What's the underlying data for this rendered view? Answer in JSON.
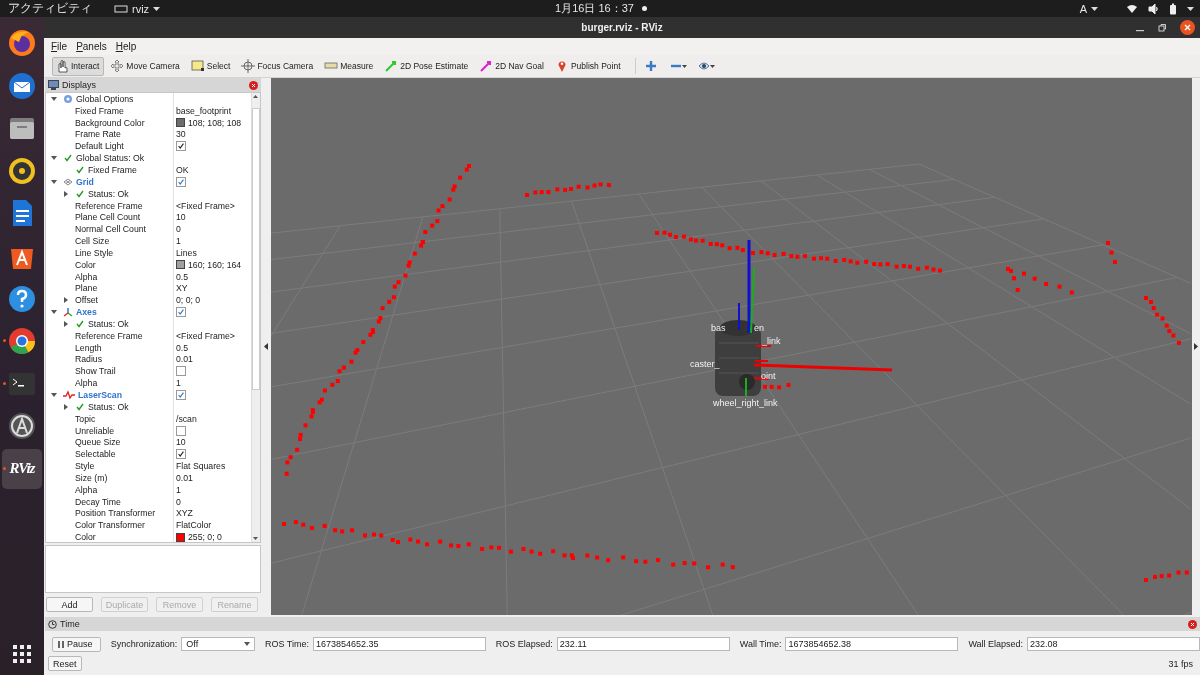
{
  "top_bar": {
    "activities": "アクティビティ",
    "app_menu": "rviz",
    "clock": "1月16日 16：37",
    "input_method": "A"
  },
  "dock": {
    "items": [
      {
        "kind": "firefox",
        "running": false,
        "selected": false
      },
      {
        "kind": "thunderbird",
        "running": false,
        "selected": false
      },
      {
        "kind": "files",
        "running": false,
        "selected": false
      },
      {
        "kind": "rhythmbox",
        "running": false,
        "selected": false
      },
      {
        "kind": "writer",
        "running": false,
        "selected": false
      },
      {
        "kind": "software",
        "running": false,
        "selected": false
      },
      {
        "kind": "help",
        "running": false,
        "selected": false
      },
      {
        "kind": "chrome",
        "running": true,
        "selected": false
      },
      {
        "kind": "terminal",
        "running": true,
        "selected": false
      },
      {
        "kind": "updater",
        "running": false,
        "selected": false
      },
      {
        "kind": "rviz",
        "label": "RViz",
        "running": true,
        "selected": true
      }
    ]
  },
  "window": {
    "title": "burger.rviz - RViz"
  },
  "menu": [
    "File",
    "Panels",
    "Help"
  ],
  "toolbar": [
    {
      "kind": "interact",
      "label": "Interact",
      "selected": true
    },
    {
      "kind": "move_camera",
      "label": "Move Camera",
      "selected": false
    },
    {
      "kind": "select",
      "label": "Select",
      "selected": false
    },
    {
      "kind": "focus_camera",
      "label": "Focus Camera",
      "selected": false
    },
    {
      "kind": "measure",
      "label": "Measure",
      "selected": false
    },
    {
      "kind": "pose_estimate",
      "label": "2D Pose Estimate",
      "selected": false
    },
    {
      "kind": "nav_goal",
      "label": "2D Nav Goal",
      "selected": false
    },
    {
      "kind": "publish_point",
      "label": "Publish Point",
      "selected": false
    }
  ],
  "displays": {
    "title": "Displays",
    "items": [
      {
        "kind": "group",
        "label": "Global Options",
        "expanded": true,
        "children": [
          {
            "kind": "property",
            "label": "Fixed Frame",
            "value": "base_footprint"
          },
          {
            "kind": "color_property",
            "label": "Background Color",
            "color": "#6c6c6c",
            "value": "108; 108; 108"
          },
          {
            "kind": "property",
            "label": "Frame Rate",
            "value": "30"
          },
          {
            "kind": "check_property",
            "label": "Default Light",
            "checked": true
          }
        ]
      },
      {
        "kind": "status",
        "label": "Global Status: Ok",
        "expanded": true,
        "children": [
          {
            "kind": "status",
            "label": "Fixed Frame",
            "value": "OK"
          }
        ]
      },
      {
        "kind": "grid",
        "label": "Grid",
        "checked": true,
        "expanded": true,
        "children": [
          {
            "kind": "status",
            "label": "Status: Ok",
            "expanded": false
          },
          {
            "kind": "property",
            "label": "Reference Frame",
            "value": "<Fixed Frame>"
          },
          {
            "kind": "property",
            "label": "Plane Cell Count",
            "value": "10"
          },
          {
            "kind": "property",
            "label": "Normal Cell Count",
            "value": "0"
          },
          {
            "kind": "property",
            "label": "Cell Size",
            "value": "1"
          },
          {
            "kind": "property",
            "label": "Line Style",
            "value": "Lines"
          },
          {
            "kind": "color_property",
            "label": "Color",
            "color": "#a0a0a4",
            "value": "160; 160; 164"
          },
          {
            "kind": "property",
            "label": "Alpha",
            "value": "0.5"
          },
          {
            "kind": "property",
            "label": "Plane",
            "value": "XY"
          },
          {
            "kind": "property",
            "label": "Offset",
            "value": "0; 0; 0",
            "expanded": false
          }
        ]
      },
      {
        "kind": "axes",
        "label": "Axes",
        "checked": true,
        "expanded": true,
        "children": [
          {
            "kind": "status",
            "label": "Status: Ok",
            "expanded": false
          },
          {
            "kind": "property",
            "label": "Reference Frame",
            "value": "<Fixed Frame>"
          },
          {
            "kind": "property",
            "label": "Length",
            "value": "0.5"
          },
          {
            "kind": "property",
            "label": "Radius",
            "value": "0.01"
          },
          {
            "kind": "check_property",
            "label": "Show Trail",
            "checked": false
          },
          {
            "kind": "property",
            "label": "Alpha",
            "value": "1"
          }
        ]
      },
      {
        "kind": "laserscan",
        "label": "LaserScan",
        "checked": true,
        "expanded": true,
        "children": [
          {
            "kind": "status",
            "label": "Status: Ok",
            "expanded": false
          },
          {
            "kind": "property",
            "label": "Topic",
            "value": "/scan"
          },
          {
            "kind": "check_property",
            "label": "Unreliable",
            "checked": false
          },
          {
            "kind": "property",
            "label": "Queue Size",
            "value": "10"
          },
          {
            "kind": "check_property",
            "label": "Selectable",
            "checked": true
          },
          {
            "kind": "property",
            "label": "Style",
            "value": "Flat Squares"
          },
          {
            "kind": "property",
            "label": "Size (m)",
            "value": "0.01"
          },
          {
            "kind": "property",
            "label": "Alpha",
            "value": "1"
          },
          {
            "kind": "property",
            "label": "Decay Time",
            "value": "0"
          },
          {
            "kind": "property",
            "label": "Position Transformer",
            "value": "XYZ"
          },
          {
            "kind": "property",
            "label": "Color Transformer",
            "value": "FlatColor"
          },
          {
            "kind": "color_property",
            "label": "Color",
            "color": "#ff0000",
            "value": "255; 0; 0"
          }
        ]
      }
    ],
    "buttons": [
      {
        "label": "Add",
        "disabled": false
      },
      {
        "label": "Duplicate",
        "disabled": true
      },
      {
        "label": "Remove",
        "disabled": true
      },
      {
        "label": "Rename",
        "disabled": true
      }
    ]
  },
  "view": {
    "frame_labels": [
      "bas",
      "en",
      "_link",
      "caster_",
      "oint",
      "wheel_right_link"
    ]
  },
  "time_panel": {
    "title": "Time",
    "pause": "Pause",
    "sync_label": "Synchronization:",
    "sync_value": "Off",
    "fields": [
      {
        "label": "ROS Time:",
        "value": "1673854652.35"
      },
      {
        "label": "ROS Elapsed:",
        "value": "232.11"
      },
      {
        "label": "Wall Time:",
        "value": "1673854652.38"
      },
      {
        "label": "Wall Elapsed:",
        "value": "232.08"
      }
    ],
    "reset": "Reset",
    "fps": "31 fps"
  }
}
